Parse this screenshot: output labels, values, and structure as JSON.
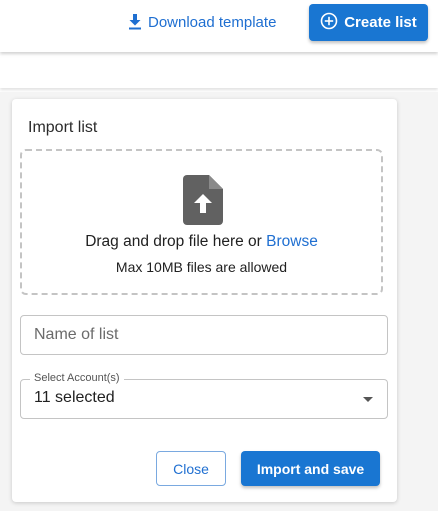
{
  "header": {
    "download_label": "Download template",
    "download_icon": "download-icon",
    "create_label": "Create list",
    "create_icon": "add-circle-icon"
  },
  "import_card": {
    "title": "Import list",
    "dropzone": {
      "icon": "file-upload-icon",
      "main_text": "Drag and drop file here or ",
      "browse_label": "Browse",
      "sub_text": "Max 10MB files are allowed"
    },
    "name_input": {
      "placeholder": "Name of list",
      "value": ""
    },
    "account_select": {
      "label": "Select Account(s)",
      "value": "11 selected"
    },
    "buttons": {
      "close": "Close",
      "import_save": "Import and save"
    }
  },
  "colors": {
    "accent": "#1976d2",
    "link": "#1f6fd1",
    "border": "#c4c4c4",
    "page_bg": "#f4f4f4"
  }
}
